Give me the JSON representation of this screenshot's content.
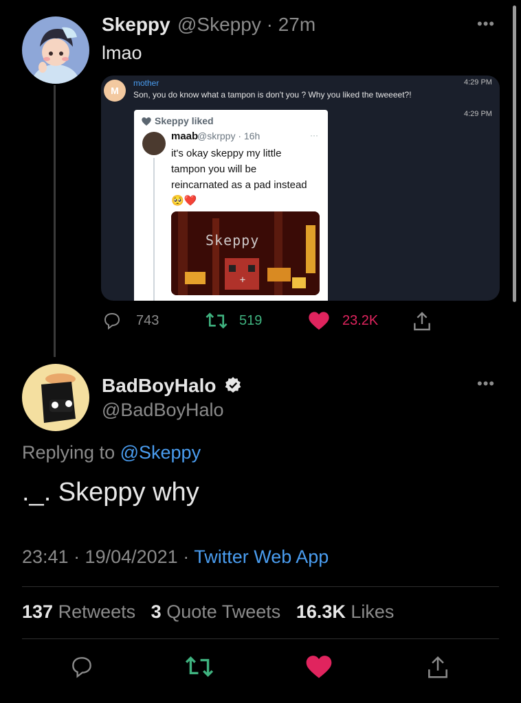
{
  "tweet1": {
    "name": "Skeppy",
    "handle_time": "@Skeppy · 27m",
    "text": "lmao",
    "more": "•••",
    "embed": {
      "sender": "mother",
      "sender_initial": "M",
      "message": "Son, you do know what a tampon is don't you ? Why you liked the tweeeet?!",
      "time1": "4:29 PM",
      "time2": "4:29 PM",
      "card": {
        "liked_label": "Skeppy liked",
        "name": "maab",
        "handle_time": "@skrppy · 16h",
        "dots": "···",
        "text": "it's okay skeppy my little tampon you will be reincarnated as a pad instead 🥺❤️",
        "image_text": "Skeppy"
      }
    },
    "actions": {
      "replies": "743",
      "retweets": "519",
      "likes": "23.2K"
    }
  },
  "tweet2": {
    "name": "BadBoyHalo",
    "handle": "@BadBoyHalo",
    "more": "•••",
    "replying_prefix": "Replying to",
    "replying_to": "@Skeppy",
    "text": "._. Skeppy why",
    "time_date": "23:41 · 19/04/2021 · ",
    "source": "Twitter Web App",
    "stats": {
      "retweets_count": "137",
      "retweets_label": "Retweets",
      "quotes_count": "3",
      "quotes_label": "Quote Tweets",
      "likes_count": "16.3K",
      "likes_label": "Likes"
    }
  },
  "colors": {
    "background": "#000000",
    "accent_blue": "#4a9df0",
    "retweet_green": "#3fb27f",
    "like_red": "#e0245e",
    "muted": "#8b8b8b"
  },
  "icons": [
    "reply-icon",
    "retweet-icon",
    "like-icon",
    "share-icon",
    "verified-icon",
    "more-icon"
  ]
}
